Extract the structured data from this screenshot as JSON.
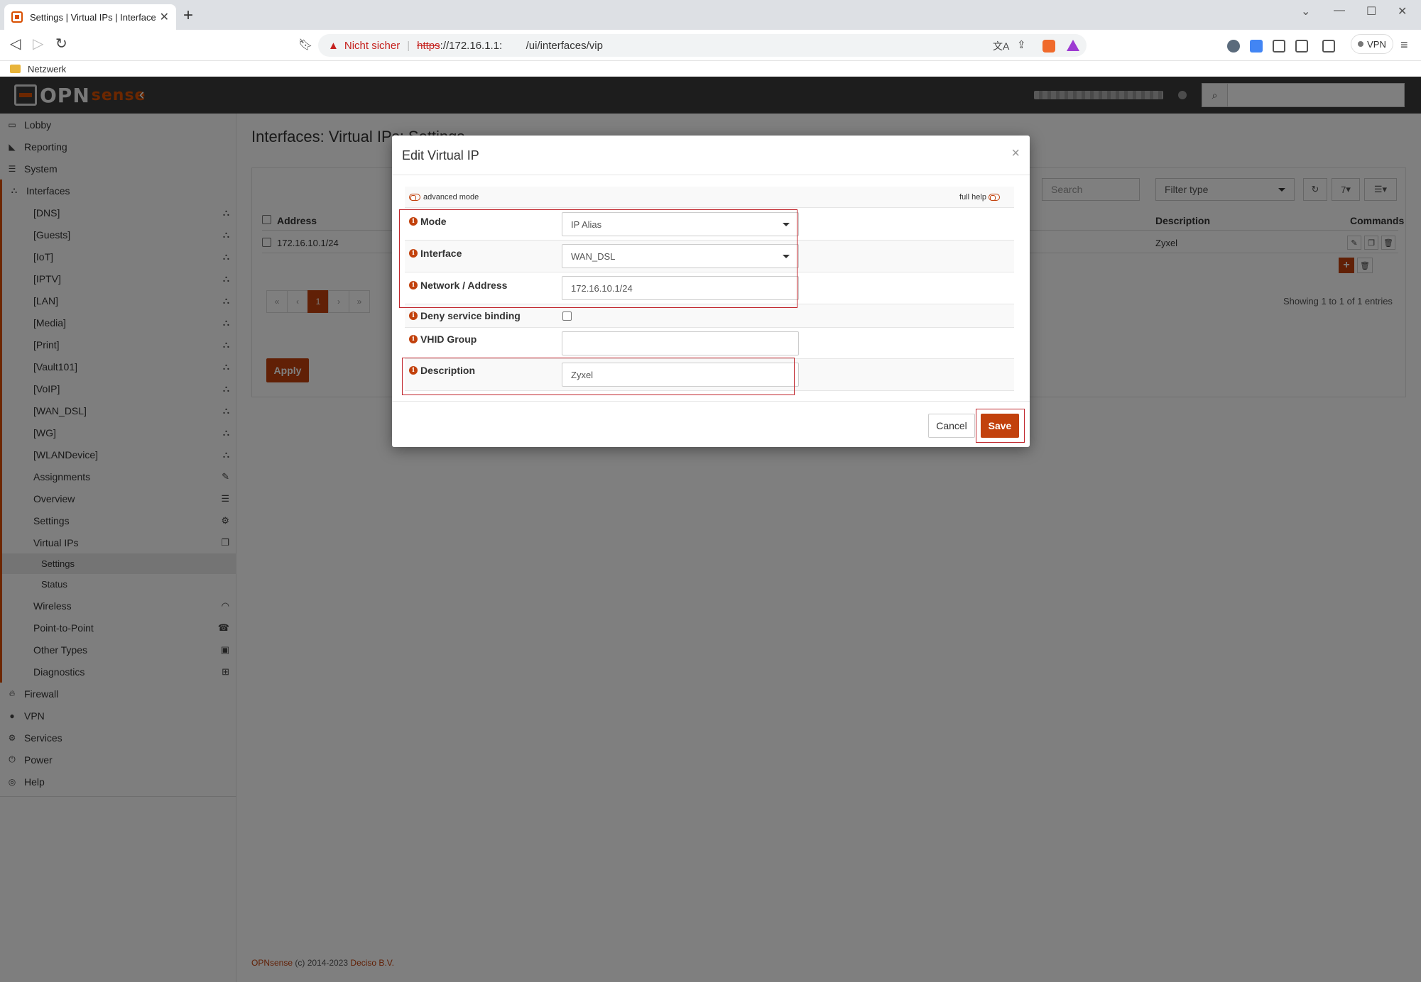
{
  "browser": {
    "tab_title": "Settings | Virtual IPs | Interfaces |",
    "new_tab": "+",
    "security_label": "Nicht sicher",
    "url_scheme": "https",
    "url_rest": "://172.16.1.1:        /ui/interfaces/vip",
    "vpn_label": "VPN",
    "bookmark": "Netzwerk"
  },
  "header": {
    "logo_opn": "OPN",
    "logo_sense": "sense"
  },
  "sidebar": {
    "top": [
      {
        "label": "Lobby",
        "icon": "laptop-icon"
      },
      {
        "label": "Reporting",
        "icon": "chart-icon"
      },
      {
        "label": "System",
        "icon": "server-icon"
      },
      {
        "label": "Interfaces",
        "icon": "sitemap-icon"
      }
    ],
    "interfaces": [
      "[DNS]",
      "[Guests]",
      "[IoT]",
      "[IPTV]",
      "[LAN]",
      "[Media]",
      "[Print]",
      "[Vault101]",
      "[VoIP]",
      "[WAN_DSL]",
      "[WG]",
      "[WLANDevice]",
      "Assignments",
      "Overview",
      "Settings",
      "Virtual IPs"
    ],
    "vip_sub": [
      "Settings",
      "Status"
    ],
    "interfaces_more": [
      "Wireless",
      "Point-to-Point",
      "Other Types",
      "Diagnostics"
    ],
    "bottom": [
      {
        "label": "Firewall",
        "icon": "fire-icon"
      },
      {
        "label": "VPN",
        "icon": "globe-icon"
      },
      {
        "label": "Services",
        "icon": "cog-icon"
      },
      {
        "label": "Power",
        "icon": "plug-icon"
      },
      {
        "label": "Help",
        "icon": "lifebuoy-icon"
      }
    ]
  },
  "page": {
    "title": "Interfaces: Virtual IPs: Settings",
    "search_placeholder": "Search",
    "filter_placeholder": "Filter type",
    "rows_count": "7",
    "columns": {
      "address": "Address",
      "description": "Description",
      "commands": "Commands"
    },
    "row": {
      "address": "172.16.10.1/24",
      "description": "Zyxel"
    },
    "pager": [
      "«",
      "‹",
      "1",
      "›",
      "»"
    ],
    "showing": "Showing 1 to 1 of 1 entries",
    "apply": "Apply",
    "footer_brand": "OPNsense",
    "footer_mid": " (c) 2014-2023 ",
    "footer_company": "Deciso B.V."
  },
  "modal": {
    "title": "Edit Virtual IP",
    "close": "×",
    "advanced_mode": "advanced mode",
    "full_help": "full help",
    "fields": {
      "mode_label": "Mode",
      "mode_value": "IP Alias",
      "interface_label": "Interface",
      "interface_value": "WAN_DSL",
      "network_label": "Network / Address",
      "network_value": "172.16.10.1/24",
      "deny_label": "Deny service binding",
      "vhid_label": "VHID Group",
      "vhid_value": "",
      "description_label": "Description",
      "description_value": "Zyxel"
    },
    "cancel": "Cancel",
    "save": "Save"
  },
  "colors": {
    "accent": "#c2410c",
    "header_bg": "#3a3a3a",
    "highlight_box": "#c0262d"
  }
}
